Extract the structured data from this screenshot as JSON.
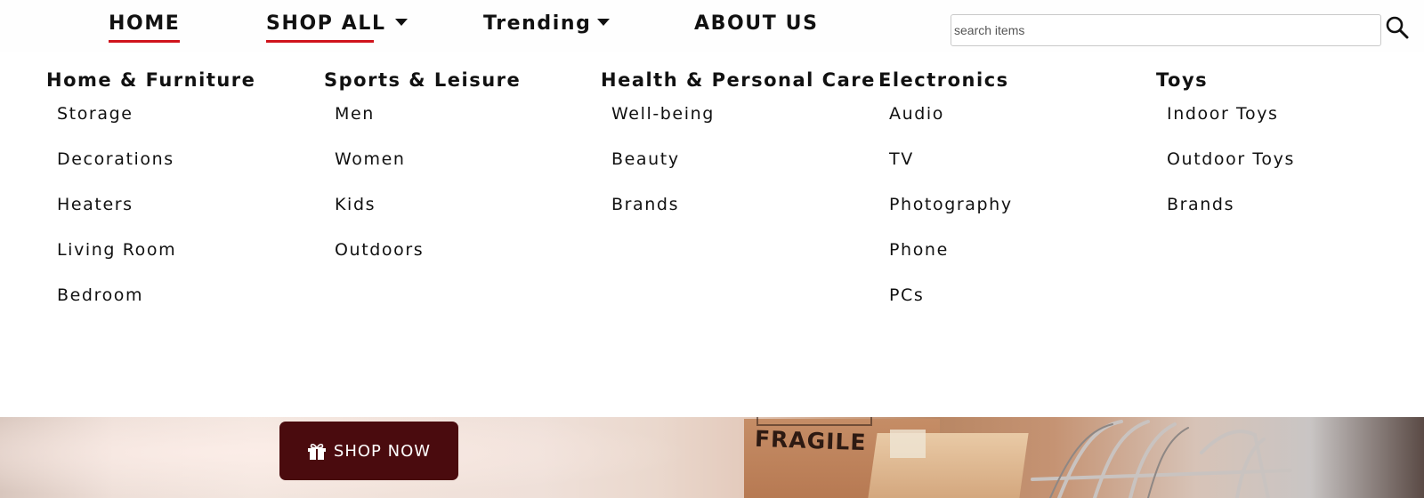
{
  "nav": {
    "home": "HOME",
    "shop_all": "SHOP ALL",
    "trending": "Trending",
    "about": "ABOUT US",
    "accent_color": "#d0141c"
  },
  "search": {
    "placeholder": "search items",
    "value": ""
  },
  "mega_menu": {
    "columns": [
      {
        "heading": "Home & Furniture",
        "items": [
          "Storage",
          "Decorations",
          "Heaters",
          "Living Room",
          "Bedroom"
        ]
      },
      {
        "heading": "Sports & Leisure",
        "items": [
          "Men",
          "Women",
          "Kids",
          "Outdoors"
        ]
      },
      {
        "heading": "Health & Personal Care",
        "items": [
          "Well-being",
          "Beauty",
          "Brands"
        ]
      },
      {
        "heading": "Electronics",
        "items": [
          "Audio",
          "TV",
          "Photography",
          "Phone",
          "PCs"
        ]
      },
      {
        "heading": "Toys",
        "items": [
          "Indoor Toys",
          "Outdoor Toys",
          "Brands"
        ]
      }
    ]
  },
  "hero": {
    "box_text": "FRAGILE",
    "button_label": "SHOP NOW",
    "button_color": "#4a0b0e",
    "button_icon": "gift-icon"
  }
}
